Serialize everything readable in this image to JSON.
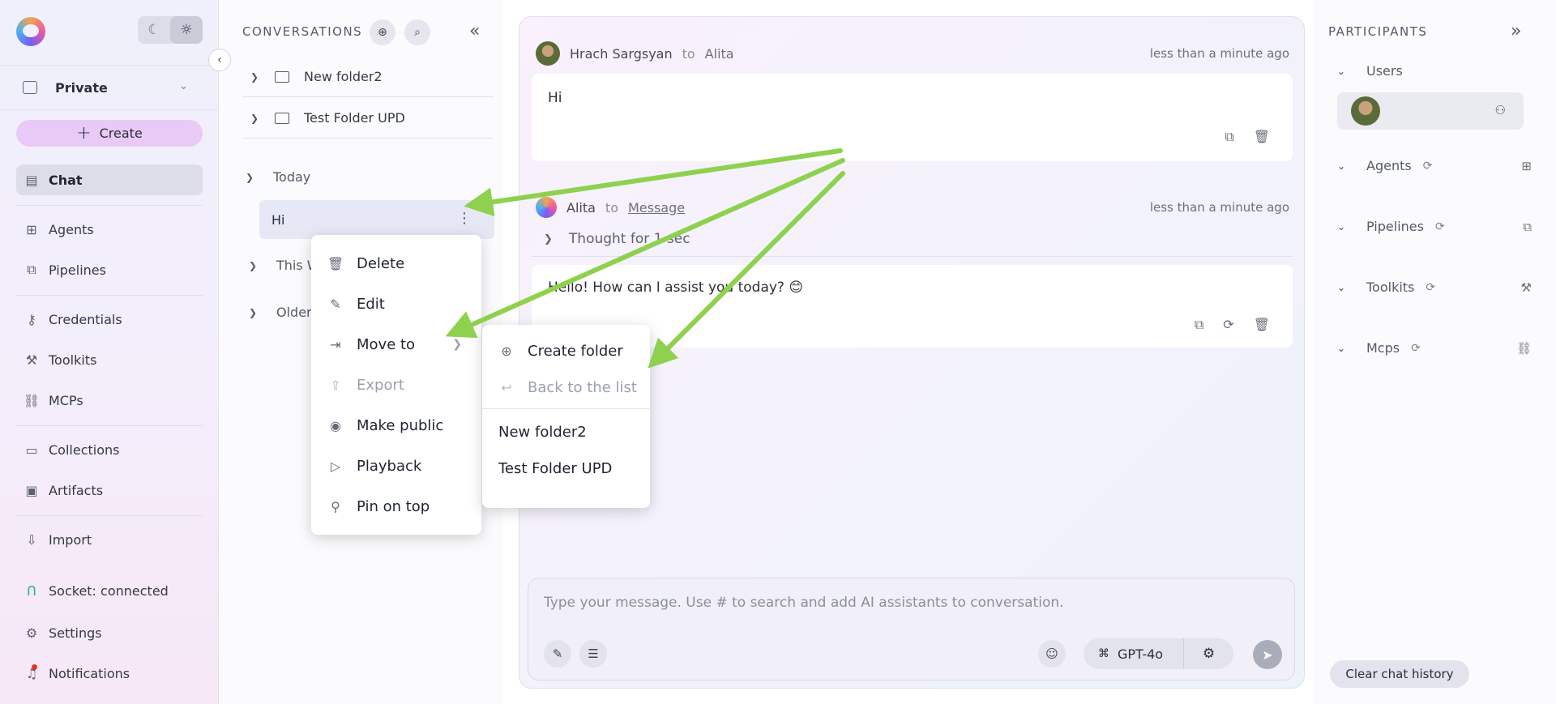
{
  "colors": {
    "accent": "#e9c9f5",
    "arrow": "#8fd14f",
    "active_bg": "#dcdde8"
  },
  "theme": {
    "dark_icon": "moon-icon",
    "light_icon": "sun-icon"
  },
  "project": {
    "label": "Private"
  },
  "create": {
    "label": "Create"
  },
  "nav": {
    "chat": "Chat",
    "agents": "Agents",
    "pipelines": "Pipelines",
    "credentials": "Credentials",
    "toolkits": "Toolkits",
    "mcps": "MCPs",
    "collections": "Collections",
    "artifacts": "Artifacts",
    "import": "Import",
    "socket": "Socket: connected",
    "settings": "Settings",
    "notifications": "Notifications"
  },
  "conversations": {
    "title": "CONVERSATIONS",
    "folders": [
      "New folder2",
      "Test Folder UPD"
    ],
    "groups": {
      "today": "Today",
      "this_week": "This W",
      "older": "Older"
    },
    "items": [
      "Hi"
    ]
  },
  "context_menu": {
    "delete": "Delete",
    "edit": "Edit",
    "move_to": "Move to",
    "export": "Export",
    "make_public": "Make public",
    "playback": "Playback",
    "pin_on_top": "Pin on top"
  },
  "move_menu": {
    "create_folder": "Create folder",
    "back_to_list": "Back to the list",
    "folders": [
      "New folder2",
      "Test Folder UPD"
    ]
  },
  "chat": {
    "messages": [
      {
        "author": "Hrach Sargsyan",
        "to": "to",
        "target": "Alita",
        "time": "less than a minute ago",
        "text": "Hi"
      },
      {
        "author": "Alita",
        "to": "to",
        "target": "Message",
        "time": "less than a minute ago",
        "thought": "Thought for 1 sec",
        "text": "Hello! How can I assist you today? 😊"
      }
    ],
    "input_placeholder": "Type your message. Use # to search and add AI assistants to conversation.",
    "model": "GPT-4o"
  },
  "participants": {
    "title": "PARTICIPANTS",
    "users": "Users",
    "agents": "Agents",
    "pipelines": "Pipelines",
    "toolkits": "Toolkits",
    "mcps": "Mcps",
    "clear_history": "Clear chat history"
  }
}
